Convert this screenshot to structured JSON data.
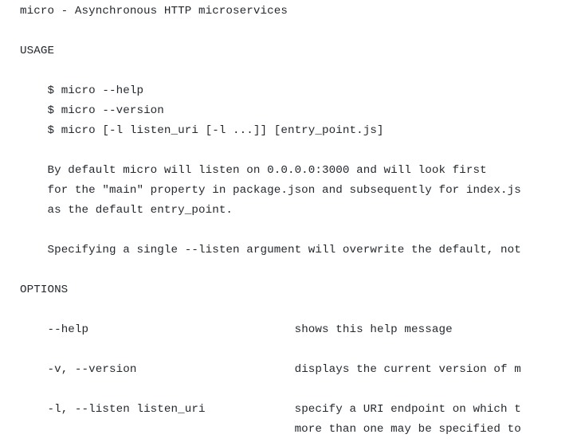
{
  "header": "micro - Asynchronous HTTP microservices",
  "usage": {
    "title": "USAGE",
    "lines": [
      "$ micro --help",
      "$ micro --version",
      "$ micro [-l listen_uri [-l ...]] [entry_point.js]"
    ],
    "desc1_l1": "By default micro will listen on 0.0.0.0:3000 and will look first",
    "desc1_l2": "for the \"main\" property in package.json and subsequently for index.js",
    "desc1_l3": "as the default entry_point.",
    "desc2": "Specifying a single --listen argument will overwrite the default, not"
  },
  "options": {
    "title": "OPTIONS",
    "items": [
      {
        "flag": "--help",
        "desc": "shows this help message"
      },
      {
        "flag": "-v, --version",
        "desc": "displays the current version of m"
      },
      {
        "flag": "-l, --listen listen_uri",
        "desc": "specify a URI endpoint on which t"
      },
      {
        "flag": "",
        "desc": "more than one may be specified to"
      }
    ]
  }
}
